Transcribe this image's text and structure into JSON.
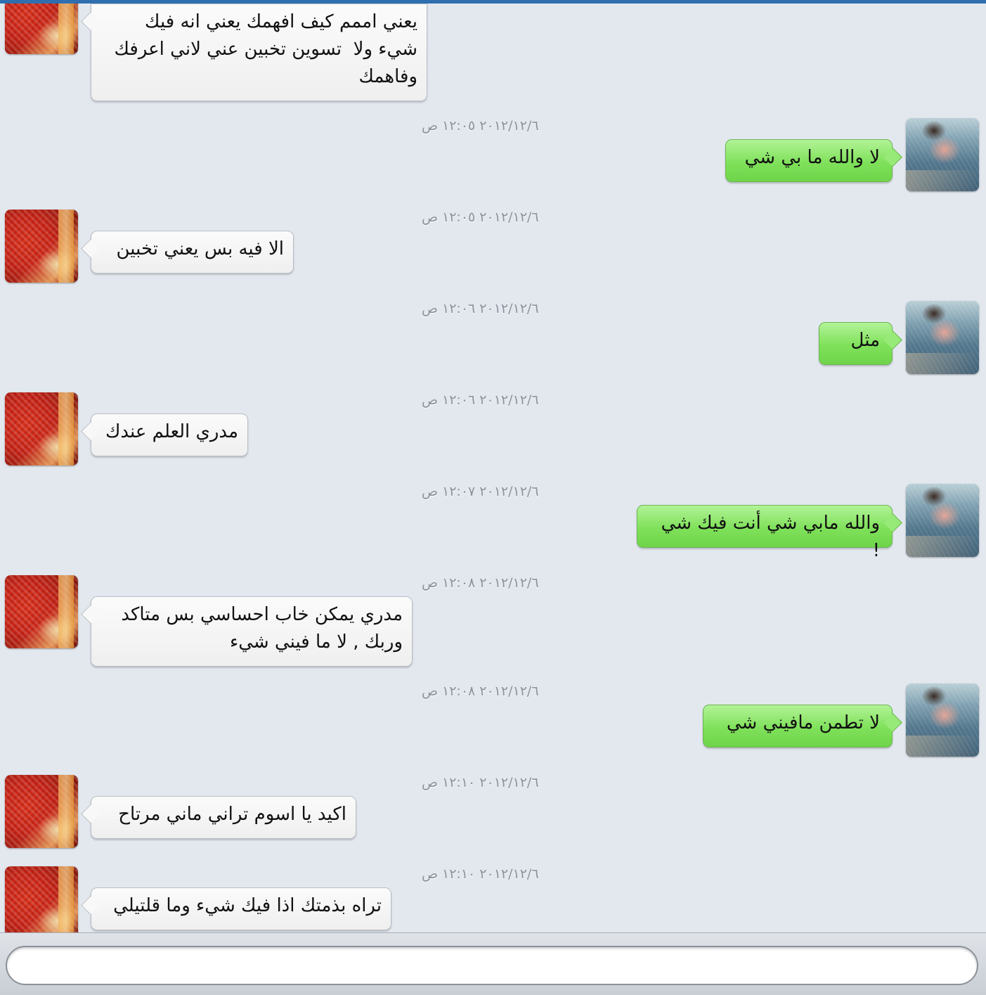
{
  "header": {
    "accent_color": "#2f6fb0"
  },
  "messages": [
    {
      "sender": "them",
      "text": "يعني اممم كيف افهمك يعني انه فيك\nشيء ولا  تسوين تخبين عني لاني اعرفك\nوفاهمك"
    },
    {
      "sender": "me",
      "timestamp": "٢٠١٢/١٢/٦ ١٢:٠٥ ص",
      "text": "لا والله ما بي شي"
    },
    {
      "sender": "them",
      "timestamp": "٢٠١٢/١٢/٦ ١٢:٠٥ ص",
      "text": "الا فيه بس يعني تخبين"
    },
    {
      "sender": "me",
      "timestamp": "٢٠١٢/١٢/٦ ١٢:٠٦ ص",
      "text": "مثل"
    },
    {
      "sender": "them",
      "timestamp": "٢٠١٢/١٢/٦ ١٢:٠٦ ص",
      "text": "مدري العلم عندك"
    },
    {
      "sender": "me",
      "timestamp": "٢٠١٢/١٢/٦ ١٢:٠٧ ص",
      "text": "والله مابي شي أنت فيك شي !"
    },
    {
      "sender": "them",
      "timestamp": "٢٠١٢/١٢/٦ ١٢:٠٨ ص",
      "text": "مدري يمكن خاب احساسي بس متاكد\nوربك , لا ما فيني شيء"
    },
    {
      "sender": "me",
      "timestamp": "٢٠١٢/١٢/٦ ١٢:٠٨ ص",
      "text": "لا تطمن مافيني شي"
    },
    {
      "sender": "them",
      "timestamp": "٢٠١٢/١٢/٦ ١٢:١٠ ص",
      "text": "اكيد يا اسوم تراني ماني مرتاح"
    },
    {
      "sender": "them",
      "timestamp": "٢٠١٢/١٢/٦ ١٢:١٠ ص",
      "text": "تراه بذمتك اذا فيك شيء وما قلتيلي"
    }
  ],
  "colors": {
    "incoming_bubble": "#f4f4f4",
    "outgoing_bubble": "#7fe15a",
    "background": "#e3e8ef"
  },
  "input": {
    "value": ""
  }
}
